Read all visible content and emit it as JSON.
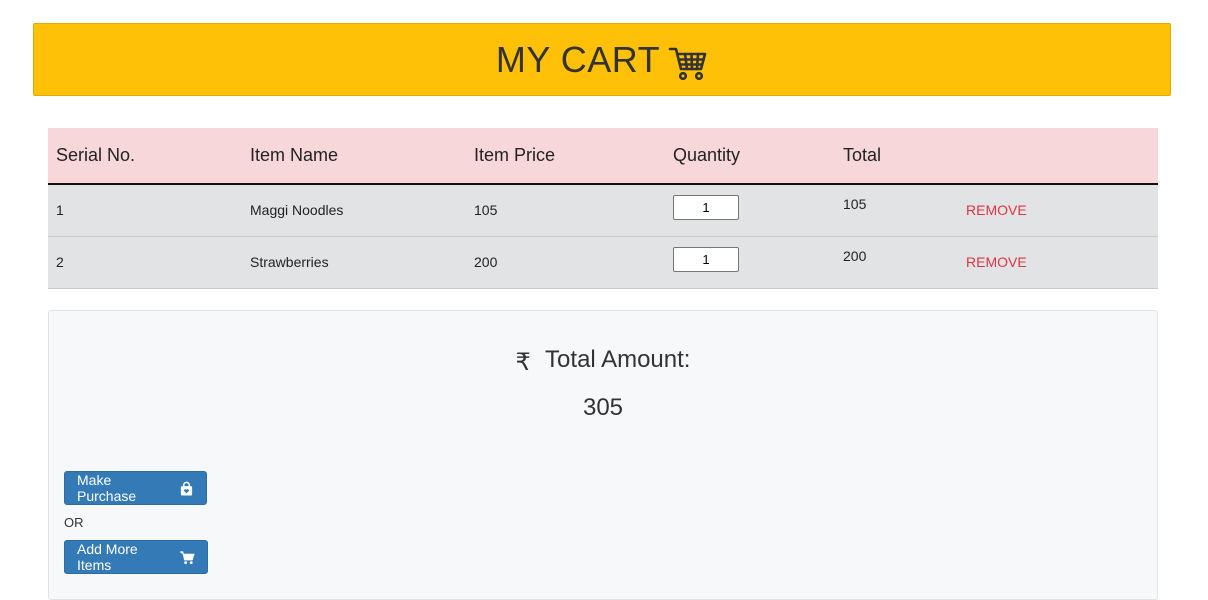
{
  "header": {
    "title": "MY CART",
    "icon": "shopping-cart-icon"
  },
  "table": {
    "columns": [
      "Serial No.",
      "Item Name",
      "Item Price",
      "Quantity",
      "Total",
      ""
    ],
    "rows": [
      {
        "serial": "1",
        "name": "Maggi Noodles",
        "price": "105",
        "quantity": "1",
        "total": "105",
        "action": "REMOVE"
      },
      {
        "serial": "2",
        "name": "Strawberries",
        "price": "200",
        "quantity": "1",
        "total": "200",
        "action": "REMOVE"
      }
    ]
  },
  "summary": {
    "currency_icon": "rupee-icon",
    "total_label": "Total Amount:",
    "total_value": "305",
    "purchase_button": "Make Purchase",
    "or_text": "OR",
    "add_more_button": "Add More Items"
  },
  "colors": {
    "header_bg": "#ffc107",
    "table_head_bg": "#f8d7da",
    "row_bg": "#e2e3e5",
    "remove": "#dc3545",
    "button": "#337ab7"
  }
}
